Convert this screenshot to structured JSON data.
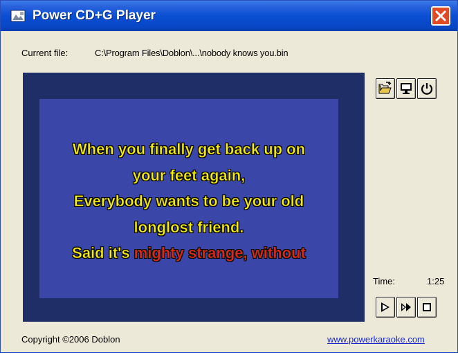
{
  "window": {
    "title": "Power CD+G Player"
  },
  "file": {
    "label": "Current file:",
    "path": "C:\\Program Files\\Doblon\\...\\nobody knows you.bin"
  },
  "lyrics": {
    "lines": [
      "When you finally get back up on",
      "your feet again,",
      "Everybody wants to be your old",
      "longlost friend."
    ],
    "current_line_sung": "Said it's ",
    "current_line_unsung": "mighty strange, without"
  },
  "side_buttons": [
    {
      "icon": "open-folder-icon"
    },
    {
      "icon": "monitor-icon"
    },
    {
      "icon": "power-icon"
    }
  ],
  "playback": {
    "time_label": "Time:",
    "time_value": "1:25",
    "buttons": [
      {
        "icon": "play-icon"
      },
      {
        "icon": "fast-forward-icon"
      },
      {
        "icon": "stop-icon"
      }
    ]
  },
  "footer": {
    "copyright": "Copyright ©2006 Doblon",
    "website": "www.powerkaraoke.com"
  },
  "colors": {
    "titlebar": "#0a4fd3",
    "screen_outer": "#1f2e66",
    "screen_inner": "#3a46a8",
    "lyric_sung": "#f3ee14",
    "lyric_unsung": "#e42222",
    "link": "#1a2ccc"
  }
}
